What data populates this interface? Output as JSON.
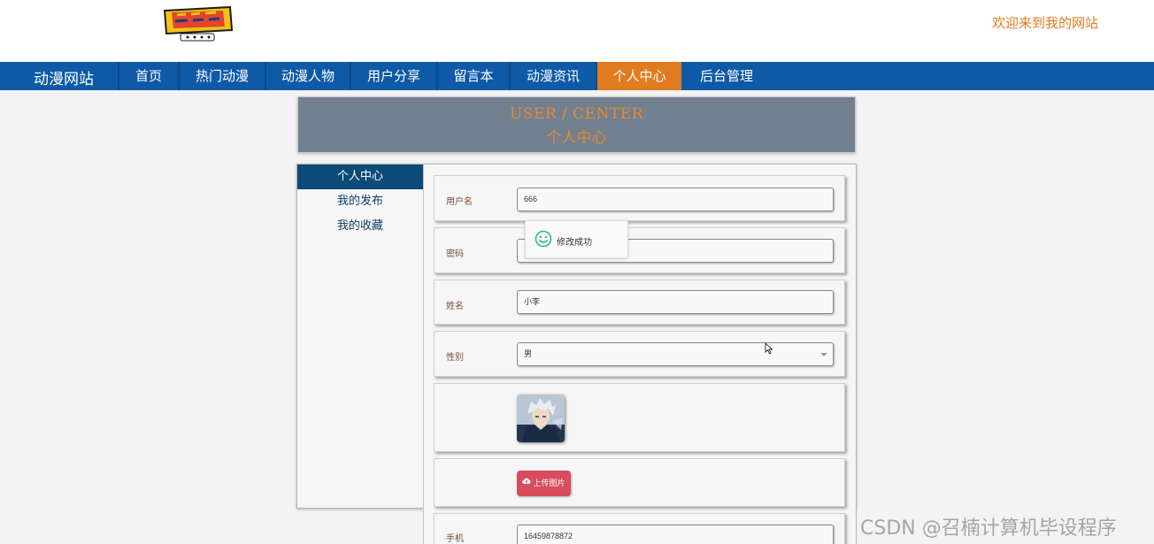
{
  "header": {
    "welcome_text": "欢迎来到我的网站",
    "logo_icon": "bigbys-logo-icon"
  },
  "nav": {
    "brand": "动漫网站",
    "items": [
      {
        "label": "首页"
      },
      {
        "label": "热门动漫"
      },
      {
        "label": "动漫人物"
      },
      {
        "label": "用户分享"
      },
      {
        "label": "留言本"
      },
      {
        "label": "动漫资讯"
      },
      {
        "label": "个人中心",
        "active": true
      },
      {
        "label": "后台管理"
      }
    ]
  },
  "banner": {
    "title_en": "USER / CENTER",
    "title_zh": "个人中心"
  },
  "sidebar": {
    "items": [
      {
        "label": "个人中心",
        "active": true
      },
      {
        "label": "我的发布"
      },
      {
        "label": "我的收藏"
      }
    ]
  },
  "form": {
    "username": {
      "label": "用户名",
      "value": "666"
    },
    "password": {
      "label": "密码",
      "value": ""
    },
    "name": {
      "label": "姓名",
      "value": "小李"
    },
    "gender": {
      "label": "性别",
      "value": "男"
    },
    "upload_label": "上传图片",
    "phone": {
      "label": "手机",
      "value": "16459878872"
    }
  },
  "toast": {
    "message": "修改成功",
    "icon": "smile-icon"
  },
  "watermark": "CSDN @召楠计算机毕设程序",
  "colors": {
    "nav_bg": "#0e5aa7",
    "accent_orange": "#e07b20",
    "sidebar_active": "#0c4a78",
    "upload_button": "#d94c5e",
    "success_green": "#2fbf71"
  }
}
